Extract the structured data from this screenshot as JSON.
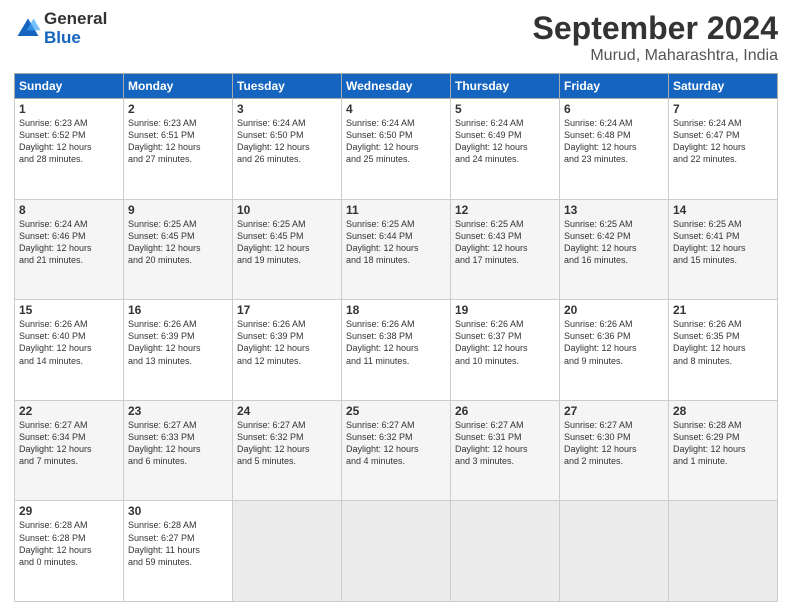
{
  "logo": {
    "general": "General",
    "blue": "Blue"
  },
  "title": "September 2024",
  "location": "Murud, Maharashtra, India",
  "days_of_week": [
    "Sunday",
    "Monday",
    "Tuesday",
    "Wednesday",
    "Thursday",
    "Friday",
    "Saturday"
  ],
  "weeks": [
    [
      {
        "day": "1",
        "info": "Sunrise: 6:23 AM\nSunset: 6:52 PM\nDaylight: 12 hours\nand 28 minutes."
      },
      {
        "day": "2",
        "info": "Sunrise: 6:23 AM\nSunset: 6:51 PM\nDaylight: 12 hours\nand 27 minutes."
      },
      {
        "day": "3",
        "info": "Sunrise: 6:24 AM\nSunset: 6:50 PM\nDaylight: 12 hours\nand 26 minutes."
      },
      {
        "day": "4",
        "info": "Sunrise: 6:24 AM\nSunset: 6:50 PM\nDaylight: 12 hours\nand 25 minutes."
      },
      {
        "day": "5",
        "info": "Sunrise: 6:24 AM\nSunset: 6:49 PM\nDaylight: 12 hours\nand 24 minutes."
      },
      {
        "day": "6",
        "info": "Sunrise: 6:24 AM\nSunset: 6:48 PM\nDaylight: 12 hours\nand 23 minutes."
      },
      {
        "day": "7",
        "info": "Sunrise: 6:24 AM\nSunset: 6:47 PM\nDaylight: 12 hours\nand 22 minutes."
      }
    ],
    [
      {
        "day": "8",
        "info": "Sunrise: 6:24 AM\nSunset: 6:46 PM\nDaylight: 12 hours\nand 21 minutes."
      },
      {
        "day": "9",
        "info": "Sunrise: 6:25 AM\nSunset: 6:45 PM\nDaylight: 12 hours\nand 20 minutes."
      },
      {
        "day": "10",
        "info": "Sunrise: 6:25 AM\nSunset: 6:45 PM\nDaylight: 12 hours\nand 19 minutes."
      },
      {
        "day": "11",
        "info": "Sunrise: 6:25 AM\nSunset: 6:44 PM\nDaylight: 12 hours\nand 18 minutes."
      },
      {
        "day": "12",
        "info": "Sunrise: 6:25 AM\nSunset: 6:43 PM\nDaylight: 12 hours\nand 17 minutes."
      },
      {
        "day": "13",
        "info": "Sunrise: 6:25 AM\nSunset: 6:42 PM\nDaylight: 12 hours\nand 16 minutes."
      },
      {
        "day": "14",
        "info": "Sunrise: 6:25 AM\nSunset: 6:41 PM\nDaylight: 12 hours\nand 15 minutes."
      }
    ],
    [
      {
        "day": "15",
        "info": "Sunrise: 6:26 AM\nSunset: 6:40 PM\nDaylight: 12 hours\nand 14 minutes."
      },
      {
        "day": "16",
        "info": "Sunrise: 6:26 AM\nSunset: 6:39 PM\nDaylight: 12 hours\nand 13 minutes."
      },
      {
        "day": "17",
        "info": "Sunrise: 6:26 AM\nSunset: 6:39 PM\nDaylight: 12 hours\nand 12 minutes."
      },
      {
        "day": "18",
        "info": "Sunrise: 6:26 AM\nSunset: 6:38 PM\nDaylight: 12 hours\nand 11 minutes."
      },
      {
        "day": "19",
        "info": "Sunrise: 6:26 AM\nSunset: 6:37 PM\nDaylight: 12 hours\nand 10 minutes."
      },
      {
        "day": "20",
        "info": "Sunrise: 6:26 AM\nSunset: 6:36 PM\nDaylight: 12 hours\nand 9 minutes."
      },
      {
        "day": "21",
        "info": "Sunrise: 6:26 AM\nSunset: 6:35 PM\nDaylight: 12 hours\nand 8 minutes."
      }
    ],
    [
      {
        "day": "22",
        "info": "Sunrise: 6:27 AM\nSunset: 6:34 PM\nDaylight: 12 hours\nand 7 minutes."
      },
      {
        "day": "23",
        "info": "Sunrise: 6:27 AM\nSunset: 6:33 PM\nDaylight: 12 hours\nand 6 minutes."
      },
      {
        "day": "24",
        "info": "Sunrise: 6:27 AM\nSunset: 6:32 PM\nDaylight: 12 hours\nand 5 minutes."
      },
      {
        "day": "25",
        "info": "Sunrise: 6:27 AM\nSunset: 6:32 PM\nDaylight: 12 hours\nand 4 minutes."
      },
      {
        "day": "26",
        "info": "Sunrise: 6:27 AM\nSunset: 6:31 PM\nDaylight: 12 hours\nand 3 minutes."
      },
      {
        "day": "27",
        "info": "Sunrise: 6:27 AM\nSunset: 6:30 PM\nDaylight: 12 hours\nand 2 minutes."
      },
      {
        "day": "28",
        "info": "Sunrise: 6:28 AM\nSunset: 6:29 PM\nDaylight: 12 hours\nand 1 minute."
      }
    ],
    [
      {
        "day": "29",
        "info": "Sunrise: 6:28 AM\nSunset: 6:28 PM\nDaylight: 12 hours\nand 0 minutes."
      },
      {
        "day": "30",
        "info": "Sunrise: 6:28 AM\nSunset: 6:27 PM\nDaylight: 11 hours\nand 59 minutes."
      },
      {
        "day": "",
        "info": ""
      },
      {
        "day": "",
        "info": ""
      },
      {
        "day": "",
        "info": ""
      },
      {
        "day": "",
        "info": ""
      },
      {
        "day": "",
        "info": ""
      }
    ]
  ]
}
